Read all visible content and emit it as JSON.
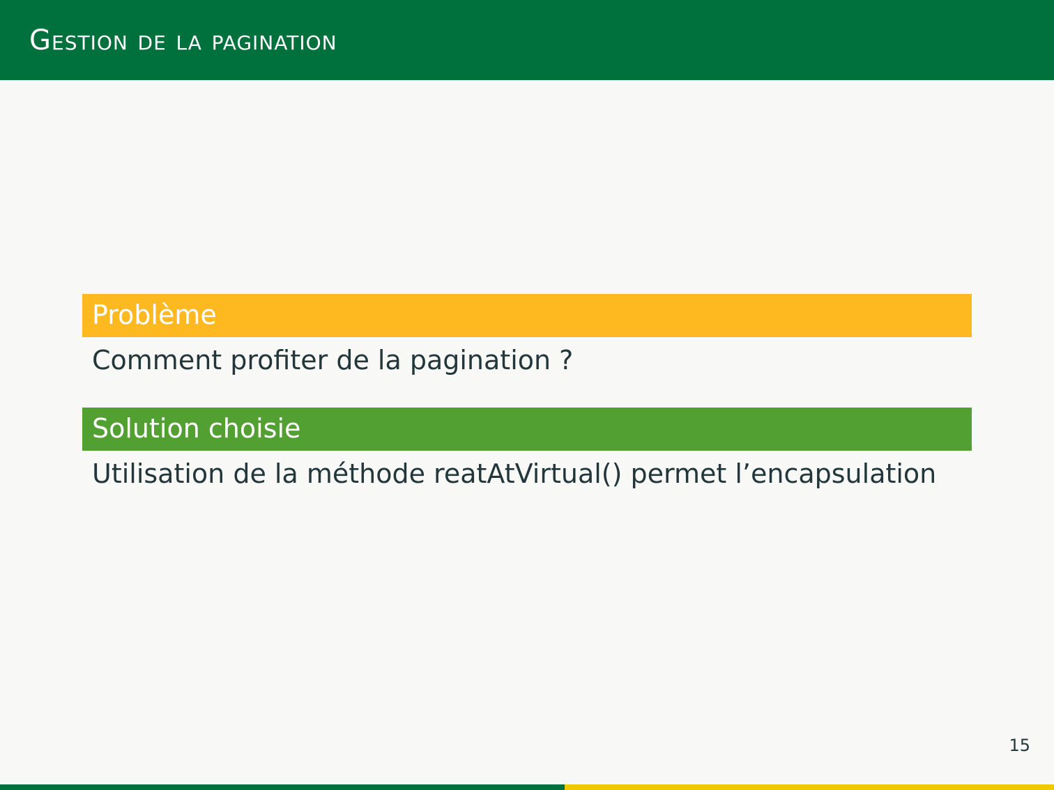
{
  "slide": {
    "title": "Gestion de la pagination",
    "page_number": "15"
  },
  "blocks": [
    {
      "header": "Problème",
      "body": "Comment profiter de la pagination ?",
      "color": "#fdb91f"
    },
    {
      "header": "Solution choisie",
      "body": "Utilisation de la méthode reatAtVirtual() permet l’encapsulation",
      "color": "#53a032"
    }
  ],
  "colors": {
    "title_bar": "#00703c",
    "footer_left": "#00703c",
    "footer_right": "#f0c800",
    "text": "#23373b",
    "background": "#f8f8f7"
  }
}
